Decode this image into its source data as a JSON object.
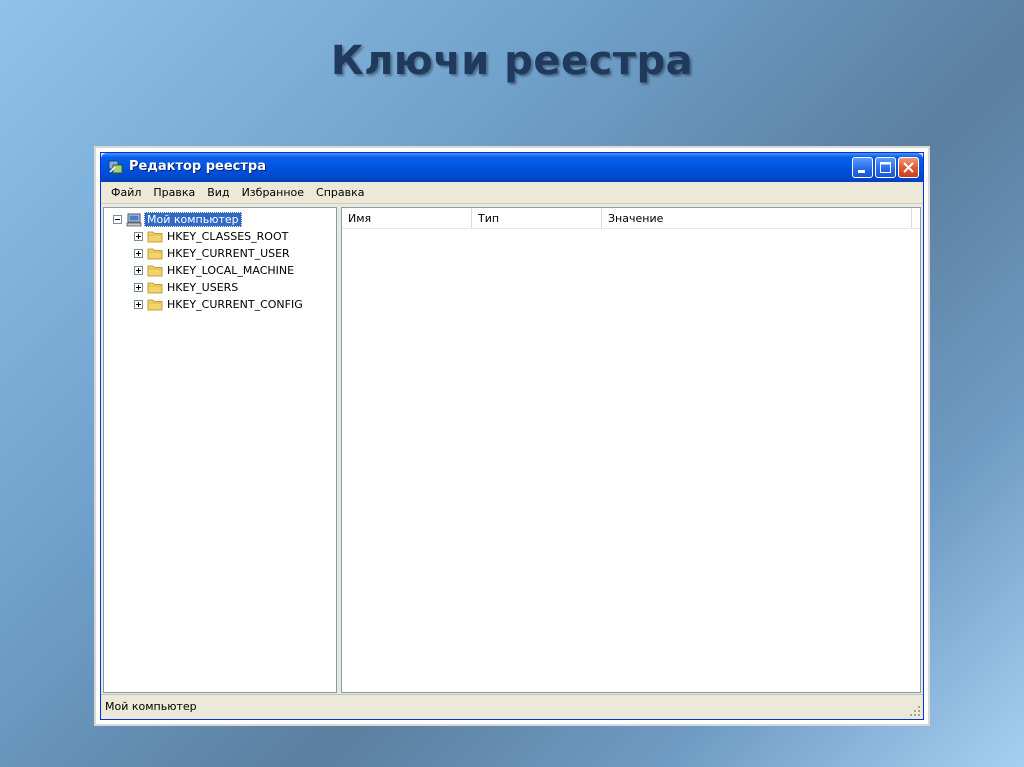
{
  "slide": {
    "title": "Ключи реестра"
  },
  "window": {
    "title": "Редактор реестра"
  },
  "menu": [
    "Файл",
    "Правка",
    "Вид",
    "Избранное",
    "Справка"
  ],
  "tree": {
    "root": "Мой компьютер",
    "keys": [
      "HKEY_CLASSES_ROOT",
      "HKEY_CURRENT_USER",
      "HKEY_LOCAL_MACHINE",
      "HKEY_USERS",
      "HKEY_CURRENT_CONFIG"
    ]
  },
  "list": {
    "columns": [
      "Имя",
      "Тип",
      "Значение"
    ]
  },
  "status": {
    "text": "Мой компьютер"
  },
  "colors": {
    "titlebar": "#0054e3",
    "selection": "#316ac5",
    "folder": "#f3d36b",
    "close_button": "#e05a32"
  },
  "icons": {
    "title": "registry-editor-icon",
    "root": "computer-icon",
    "key": "folder-icon"
  }
}
